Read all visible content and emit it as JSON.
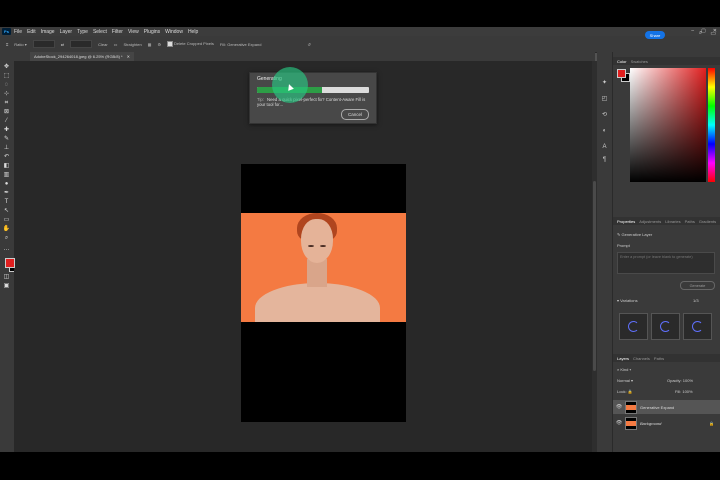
{
  "menubar": {
    "logo": "Ps",
    "items": [
      "File",
      "Edit",
      "Image",
      "Layer",
      "Type",
      "Select",
      "Filter",
      "View",
      "Plugins",
      "Window",
      "Help"
    ],
    "window_controls": [
      "–",
      "▢",
      "✕"
    ]
  },
  "options_bar": {
    "ratio": "Ratio",
    "clear": "Clear",
    "straighten": "Straighten",
    "delete_cropped": "Delete Cropped Pixels",
    "fill": "Generative Expand",
    "share": "Share"
  },
  "document_tab": "AdobeStock_294264018.jpeg @ 6.25% (RGB/8) *",
  "dialog": {
    "title": "Generating",
    "progress": 0.58,
    "tip_label": "Tip:",
    "tip_text": "Need a quick pixel-perfect fix? Content-Aware Fill is your tool for...",
    "cancel": "Cancel"
  },
  "panels": {
    "color_tabs": [
      "Color",
      "Swatches"
    ],
    "properties_tabs": [
      "Properties",
      "Adjustments",
      "Libraries",
      "Paths",
      "Gradients"
    ],
    "layer_type": "Generative Layer",
    "prompt_label": "Prompt",
    "prompt_placeholder": "Enter a prompt (or leave blank to generate)",
    "generate": "Generate",
    "variations_label": "Variations",
    "variations_count": "1/3",
    "layers_tabs": [
      "Layers",
      "Channels",
      "Paths"
    ],
    "kind_label": "Kind",
    "blend_mode": "Normal",
    "opacity_label": "Opacity:",
    "opacity_value": "100%",
    "lock_label": "Lock:",
    "fill_label": "Fill:",
    "fill_value": "100%",
    "layers": [
      {
        "name": "Generative Expand",
        "selected": true
      },
      {
        "name": "Background",
        "selected": false
      }
    ]
  },
  "colors": {
    "foreground": "#e01f1f",
    "background": "#000000",
    "photo_bg": "#f47a42",
    "progress": "#2d9d46",
    "accent": "#1473e6"
  }
}
